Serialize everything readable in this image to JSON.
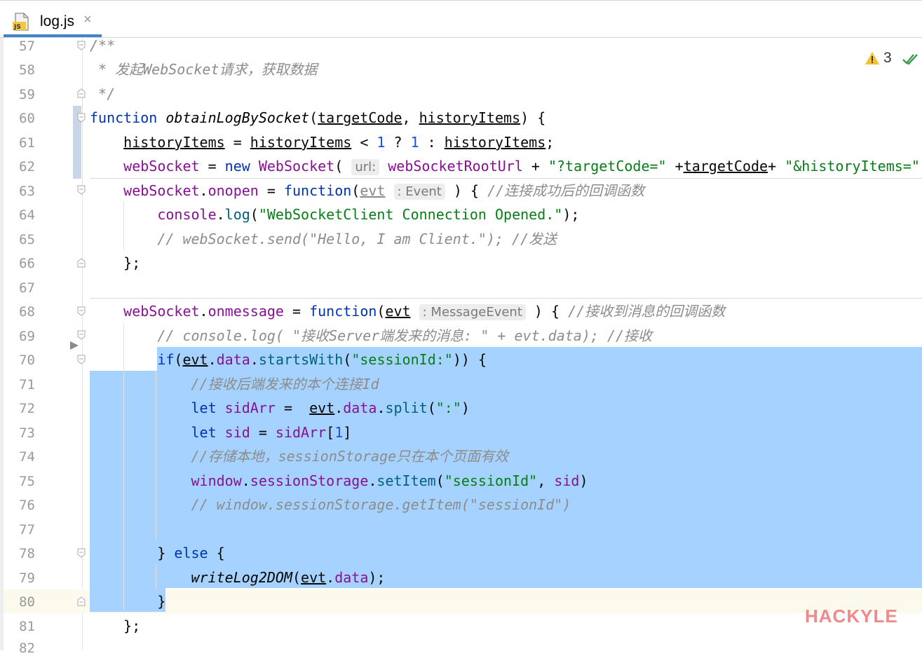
{
  "tab": {
    "icon": "js-file-icon",
    "title": "log.js",
    "close": "×"
  },
  "inspection": {
    "warnings": "3",
    "icon": "warning-icon",
    "check_icon": "double-check-icon"
  },
  "watermark": "HACKYLE",
  "lines": [
    {
      "num": "57"
    },
    {
      "num": "58"
    },
    {
      "num": "59"
    },
    {
      "num": "60"
    },
    {
      "num": "61"
    },
    {
      "num": "62"
    },
    {
      "num": "63"
    },
    {
      "num": "64"
    },
    {
      "num": "65"
    },
    {
      "num": "66"
    },
    {
      "num": "67"
    },
    {
      "num": "68"
    },
    {
      "num": "69"
    },
    {
      "num": "70"
    },
    {
      "num": "71"
    },
    {
      "num": "72"
    },
    {
      "num": "73"
    },
    {
      "num": "74"
    },
    {
      "num": "75"
    },
    {
      "num": "76"
    },
    {
      "num": "77"
    },
    {
      "num": "78"
    },
    {
      "num": "79"
    },
    {
      "num": "80"
    },
    {
      "num": "81"
    },
    {
      "num": "82"
    }
  ],
  "code": {
    "l57": "/**",
    "l58": " * 发起WebSocket请求，获取数据",
    "l59": " */",
    "l60": {
      "kw": "function",
      "name": "obtainLogBySocket",
      "p1": "targetCode",
      "p2": "historyItems"
    },
    "l61": {
      "a": "historyItems",
      "b": "historyItems",
      "n1": "1",
      "n2": "1",
      "c": "historyItems"
    },
    "l62": {
      "v": "webSocket",
      "kw": "new",
      "cls": "WebSocket",
      "hint": "url:",
      "arg": "webSocketRootUrl",
      "s1": "\"?targetCode=\"",
      "p": "targetCode",
      "s2": "\"&historyItems=\""
    },
    "l63": {
      "v": "webSocket",
      "prop": "onopen",
      "kw": "function",
      "p": "evt",
      "hint": ": Event",
      "cm": "//连接成功后的回调函数"
    },
    "l64": {
      "obj": "console",
      "m": "log",
      "s": "\"WebSocketClient Connection Opened.\""
    },
    "l65": "// webSocket.send(\"Hello, I am Client.\"); //发送",
    "l66": "};",
    "l68": {
      "v": "webSocket",
      "prop": "onmessage",
      "kw": "function",
      "p": "evt",
      "hint": ": MessageEvent",
      "cm": "//接收到消息的回调函数"
    },
    "l69": "// console.log( \"接收Server端发来的消息: \" + evt.data); //接收",
    "l70": {
      "kw": "if",
      "p": "evt",
      "prop": "data",
      "m": "startsWith",
      "s": "\"sessionId:\""
    },
    "l71": "//接收后端发来的本个连接Id",
    "l72": {
      "kw": "let",
      "v": "sidArr",
      "p": "evt",
      "prop": "data",
      "m": "split",
      "s": "\":\""
    },
    "l73": {
      "kw": "let",
      "v": "sid",
      "arr": "sidArr",
      "idx": "1"
    },
    "l74": "//存储本地，sessionStorage只在本个页面有效",
    "l75": {
      "obj": "window",
      "prop": "sessionStorage",
      "m": "setItem",
      "s": "\"sessionId\"",
      "v": "sid"
    },
    "l76": "// window.sessionStorage.getItem(\"sessionId\")",
    "l78": {
      "kw": "else"
    },
    "l79": {
      "fn": "writeLog2DOM",
      "p": "evt",
      "prop": "data"
    },
    "l80": "}",
    "l81": "};"
  }
}
